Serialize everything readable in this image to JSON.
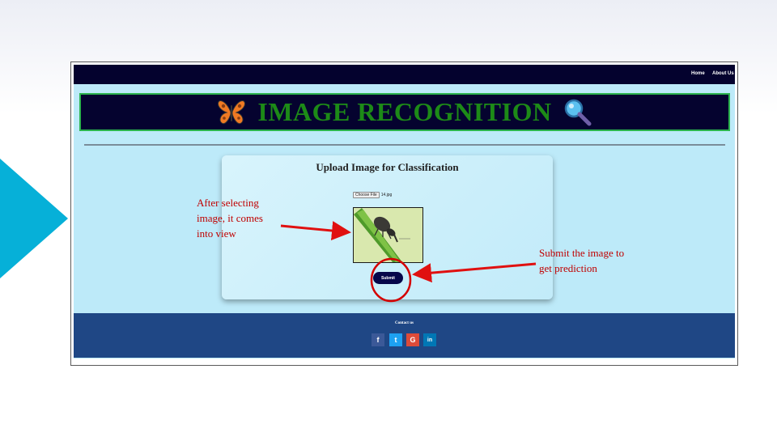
{
  "navbar": {
    "home": "Home",
    "about": "About Us"
  },
  "banner": {
    "title": "IMAGE RECOGNITION",
    "left_icon": "butterfly-icon",
    "right_icon": "magnifier-icon"
  },
  "upload": {
    "title": "Upload Image for Classification",
    "choose_file_label": "Choose File",
    "file_name": "14.jpg",
    "submit_label": "Submit"
  },
  "footer": {
    "title": "Contact us",
    "social": [
      {
        "icon": "facebook-icon",
        "glyph": "f",
        "color": "#3b5998"
      },
      {
        "icon": "twitter-icon",
        "glyph": "t",
        "color": "#1da1f2"
      },
      {
        "icon": "google-icon",
        "glyph": "G",
        "color": "#dd4b39"
      },
      {
        "icon": "linkedin-icon",
        "glyph": "in",
        "color": "#0077b5"
      }
    ]
  },
  "annotations": {
    "left": [
      "After selecting",
      "image, it comes",
      "into view"
    ],
    "right": [
      "Submit  the image to",
      "get prediction"
    ]
  },
  "colors": {
    "navbar": "#04022e",
    "page_bg": "#bdeaf9",
    "banner_text": "#1d8a17",
    "footer": "#1f4785",
    "annotation": "#c00000",
    "accent_triangle": "#06b0d8"
  }
}
